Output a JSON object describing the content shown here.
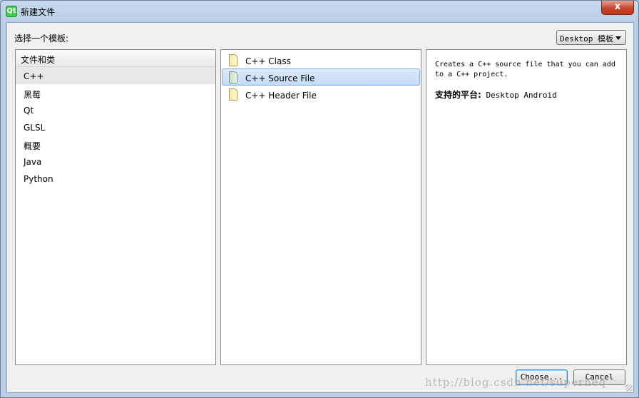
{
  "window": {
    "title": "新建文件",
    "app_icon_glyph": "Qt",
    "close_glyph": "x"
  },
  "prompt": "选择一个模板:",
  "platform_select": {
    "value": "Desktop 模板"
  },
  "categories": {
    "header": "文件和类",
    "items": [
      "C++",
      "黑莓",
      "Qt",
      "GLSL",
      "概要",
      "Java",
      "Python"
    ],
    "selected_index": 0
  },
  "templates": {
    "items": [
      {
        "label": "C++ Class",
        "icon": "header-file-icon"
      },
      {
        "label": "C++ Source File",
        "icon": "source-file-icon"
      },
      {
        "label": "C++ Header File",
        "icon": "header-file-icon"
      }
    ],
    "selected_index": 1
  },
  "description": {
    "line1": "Creates a C++ source file that you can add",
    "line2": "to a C++ project.",
    "platforms_label": "支持的平台:",
    "platforms_value": "Desktop Android"
  },
  "buttons": {
    "choose": "Choose...",
    "cancel": "Cancel"
  },
  "watermark": "http://blog.csdn.net/superheq",
  "colors": {
    "selection_bg": "#c4dbf7",
    "selection_border": "#84acdd",
    "close_red": "#c7452c"
  }
}
